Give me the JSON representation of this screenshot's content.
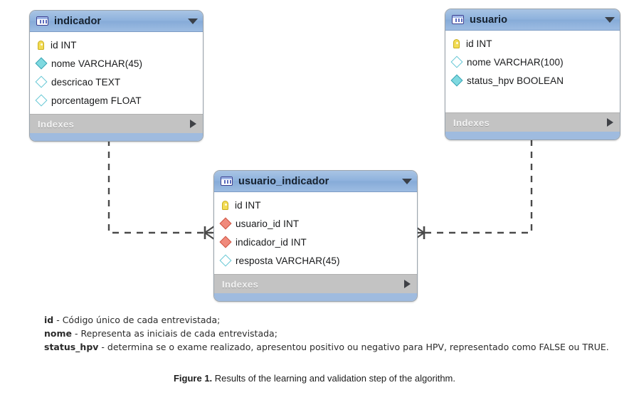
{
  "diagram": {
    "type": "entity-relationship-diagram",
    "tables": [
      {
        "name": "indicador",
        "icon": "table-icon",
        "expand_icon": "chevron-down-icon",
        "footer_label": "Indexes",
        "footer_icon": "chevron-right-icon",
        "columns": [
          {
            "label": "id INT",
            "key_type": "pk",
            "marker": "key-icon"
          },
          {
            "label": "nome VARCHAR(45)",
            "key_type": "not-null",
            "marker": "filled-diamond-icon"
          },
          {
            "label": "descricao TEXT",
            "key_type": "nullable",
            "marker": "hollow-diamond-icon"
          },
          {
            "label": "porcentagem FLOAT",
            "key_type": "nullable",
            "marker": "hollow-diamond-icon"
          }
        ]
      },
      {
        "name": "usuario",
        "icon": "table-icon",
        "expand_icon": "chevron-down-icon",
        "footer_label": "Indexes",
        "footer_icon": "chevron-right-icon",
        "columns": [
          {
            "label": "id INT",
            "key_type": "pk",
            "marker": "key-icon"
          },
          {
            "label": "nome VARCHAR(100)",
            "key_type": "nullable",
            "marker": "hollow-diamond-icon"
          },
          {
            "label": "status_hpv BOOLEAN",
            "key_type": "not-null",
            "marker": "filled-diamond-icon"
          }
        ]
      },
      {
        "name": "usuario_indicador",
        "icon": "table-icon",
        "expand_icon": "chevron-down-icon",
        "footer_label": "Indexes",
        "footer_icon": "chevron-right-icon",
        "columns": [
          {
            "label": "id INT",
            "key_type": "pk",
            "marker": "key-icon"
          },
          {
            "label": "usuario_id INT",
            "key_type": "fk",
            "marker": "red-diamond-icon"
          },
          {
            "label": "indicador_id INT",
            "key_type": "fk",
            "marker": "red-diamond-icon"
          },
          {
            "label": "resposta VARCHAR(45)",
            "key_type": "nullable",
            "marker": "hollow-diamond-icon"
          }
        ]
      }
    ],
    "relationships": [
      {
        "from": "indicador",
        "to": "usuario_indicador",
        "notation": "one-to-many",
        "line_style": "dashed"
      },
      {
        "from": "usuario",
        "to": "usuario_indicador",
        "notation": "one-to-many",
        "line_style": "dashed"
      }
    ],
    "colors": {
      "header": "#8eb2dd",
      "footer": "#c3c3c3",
      "strip": "#9fbbdf",
      "border": "#9aa4ad",
      "pk_marker": "#f3dc55",
      "nn_marker": "#7fd9e0",
      "fk_marker": "#f08a7c",
      "connector": "#4a4a4a"
    }
  },
  "legend": {
    "lines": [
      {
        "term": "id",
        "text": " - Código único de cada entrevistada;"
      },
      {
        "term": "nome",
        "text": " - Representa as iniciais de cada entrevistada;"
      },
      {
        "term": "status_hpv",
        "text": " - determina se o exame realizado, apresentou positivo ou negativo para HPV, representado como FALSE ou TRUE."
      }
    ]
  },
  "figure": {
    "number": "Figure 1.",
    "caption": " Results of the learning and validation step of the algorithm."
  }
}
